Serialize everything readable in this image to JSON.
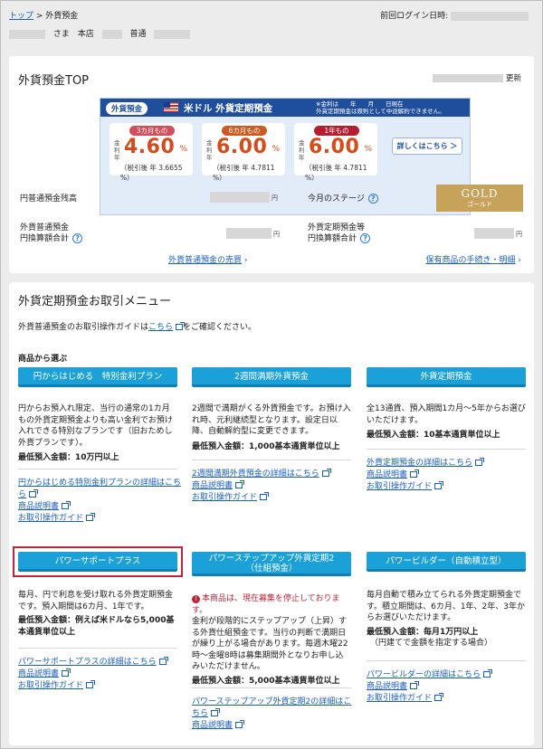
{
  "breadcrumb": {
    "top": "トップ",
    "sep": " > ",
    "current": "外貨預金"
  },
  "last_login_label": "前回ログイン日時:",
  "user": {
    "honorific": "さま",
    "branch_label": "本店",
    "account_type": "普通"
  },
  "top_section": {
    "title": "外貨預金TOP",
    "updated_label": "更新",
    "banner": {
      "tag": "外貨預金",
      "title": "米ドル 外貨定期預金",
      "note_line1": "※金利は　　年　　月　　日現在",
      "note_line2": "外貨定期預金は原則として中途解約できません。",
      "rates": [
        {
          "term": "3カ月もの",
          "year_label": "金利年",
          "rate": "4.60",
          "pct": "%",
          "tax": "（税引後 年 3.6655 %）"
        },
        {
          "term": "6カ月もの",
          "year_label": "金利年",
          "rate": "6.00",
          "pct": "%",
          "tax": "（税引後 年 4.7811 %）"
        },
        {
          "term": "1年もの",
          "year_label": "金利年",
          "rate": "6.00",
          "pct": "%",
          "tax": "（税引後 年 4.7811 %）"
        }
      ],
      "detail_button": "詳しくはこちら ＞"
    },
    "yen_balance_label": "円普通預金残高",
    "yen_unit": "円",
    "stage_label": "今月のステージ",
    "fx_label_line1": "外貨普通預金",
    "fx_label_line2": "円換算額合計",
    "fxfixed_label_line1": "外貨定期預金等",
    "fxfixed_label_line2": "円換算額合計",
    "gold": {
      "en": "GOLD",
      "ja": "ゴールド"
    },
    "link_trade": "外貨普通預金の売買",
    "link_products": "保有商品の手続き・明細"
  },
  "menu_section": {
    "title": "外貨定期預金お取引メニュー",
    "guide_prefix": "外貨普通預金のお取引操作ガイドは",
    "guide_link": "こちら",
    "guide_suffix": "をご確認ください。",
    "select_label": "商品から選ぶ",
    "products": [
      {
        "button": "円からはじめる　特別金利プラン",
        "desc": "円からお預入れ限定、当行の通常の1カ月もの外貨定期預金よりも高い金利でお預け入れできる特別なプランです（旧おためし外貨プランです）。",
        "min": "最低預入金額：10万円以上",
        "links": [
          "円からはじめる特別金利プランの詳細はこちら",
          "商品説明書",
          "お取引操作ガイド"
        ]
      },
      {
        "button": "2週間満期外貨預金",
        "desc": "2週間で満期がくる外貨預金です。お預け入れ時、元利継続型となります。設定日以降、自動解約型に変更できます。",
        "min": "最低預入金額：1,000基本通貨単位以上",
        "links": [
          "2週間満期外貨預金の詳細はこちら",
          "商品説明書",
          "お取引操作ガイド"
        ]
      },
      {
        "button": "外貨定期預金",
        "desc": "全13通貨、預入期間1カ月～5年からお選びいただけます。",
        "min": "最低預入金額：10基本通貨単位以上",
        "links": [
          "外貨定期預金の詳細はこちら",
          "商品説明書",
          "お取引操作ガイド"
        ]
      },
      {
        "button": "パワーサポートプラス",
        "desc": "毎月、円で利息を受け取れる外貨定期預金です。預入期間は6カ月、1年です。",
        "min": "最低預入金額：例えば米ドルなら5,000基本通貨単位以上",
        "links": [
          "パワーサポートプラスの詳細はこちら",
          "商品説明書",
          "お取引操作ガイド"
        ]
      },
      {
        "button_line1": "パワーステップアップ外貨定期2",
        "button_line2": "（仕組預金）",
        "warn": "本商品は、現在募集を停止しております。",
        "desc": "金利が段階的にステップアップ（上昇）する外貨仕組預金です。当行の判断で満期日が繰り上がる場合があります。毎週木曜22時～金曜8時は募集期間外となりお申し込みいただけません。",
        "min": "最低預入金額：5,000基本通貨単位以上",
        "links": [
          "パワーステップアップ外貨定期2の詳細はこちら",
          "商品説明書"
        ]
      },
      {
        "button": "パワービルダー（自動積立型）",
        "desc": "毎月自動で積み立てられる外貨定期預金です。積立期間は、6カ月、1年、2年、3年からお選びいただけます。",
        "min": "最低預入金額：毎月1万円以上",
        "min_note": "（円建てで金額を指定する場合）",
        "links": [
          "パワービルダーの詳細はこちら",
          "商品説明書",
          "お取引操作ガイド"
        ]
      }
    ]
  }
}
